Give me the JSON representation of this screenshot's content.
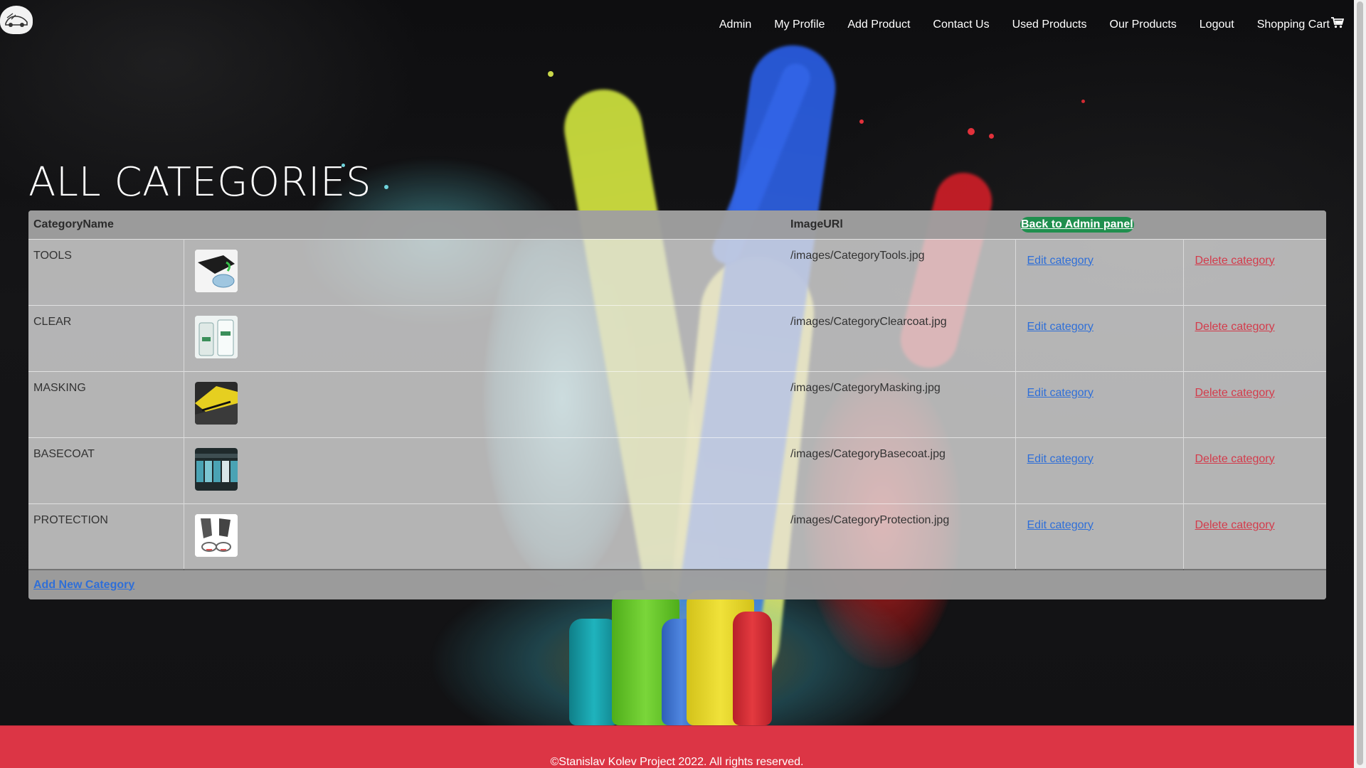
{
  "nav": {
    "links": [
      "Admin",
      "My Profile",
      "Add Product",
      "Contact Us",
      "Used Products",
      "Our Products",
      "Logout",
      "Shopping Cart"
    ]
  },
  "page": {
    "title": "ALL CATEGORIES"
  },
  "table": {
    "headers": {
      "name": "CategoryName",
      "uri": "ImageURl",
      "back_label": "Back to Admin panel"
    },
    "rows": [
      {
        "name": "TOOLS",
        "uri": "/images/CategoryTools.jpg",
        "edit": "Edit category",
        "delete": "Delete category",
        "thumb_icon": "tools-thumbnail"
      },
      {
        "name": "CLEAR",
        "uri": "/images/CategoryClearcoat.jpg",
        "edit": "Edit category",
        "delete": "Delete category",
        "thumb_icon": "clearcoat-thumbnail"
      },
      {
        "name": "MASKING",
        "uri": "/images/CategoryMasking.jpg",
        "edit": "Edit category",
        "delete": "Delete category",
        "thumb_icon": "masking-thumbnail"
      },
      {
        "name": "BASECOAT",
        "uri": "/images/CategoryBasecoat.jpg",
        "edit": "Edit category",
        "delete": "Delete category",
        "thumb_icon": "basecoat-thumbnail"
      },
      {
        "name": "PROTECTION",
        "uri": "/images/CategoryProtection.jpg",
        "edit": "Edit category",
        "delete": "Delete category",
        "thumb_icon": "protection-thumbnail"
      }
    ],
    "add_label": "Add New Category"
  },
  "footer": {
    "text": "©Stanislav Kolev Project 2022. All rights reserved."
  },
  "colors": {
    "footer": "#dc3545",
    "back_button": "#1f8f4e",
    "edit_link": "#2f6fd8",
    "delete_link": "#d33b4b"
  },
  "icons": {
    "brand": "car-logo-icon",
    "cart": "shopping-cart-icon"
  }
}
